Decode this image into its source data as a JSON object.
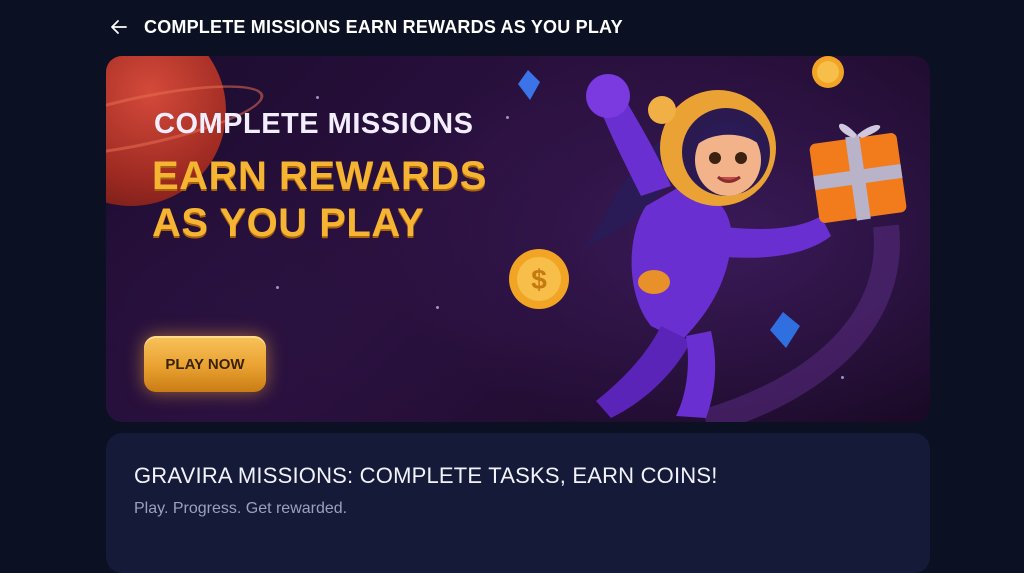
{
  "header": {
    "back_icon": "arrow-left-icon",
    "title": "COMPLETE MISSIONS EARN REWARDS AS YOU PLAY"
  },
  "banner": {
    "line1": "COMPLETE MISSIONS",
    "line2": "EARN REWARDS",
    "line3": "AS YOU PLAY",
    "cta_label": "PLAY NOW",
    "illustration": "astronaut-girl-with-gift-and-coins"
  },
  "info": {
    "title": "GRAVIRA MISSIONS: COMPLETE TASKS, EARN COINS!",
    "subtitle": "Play. Progress. Get rewarded."
  },
  "colors": {
    "background": "#0b1023",
    "card": "#151a38",
    "accent_gold": "#f5b431",
    "astronaut_purple": "#6a2fd0"
  }
}
